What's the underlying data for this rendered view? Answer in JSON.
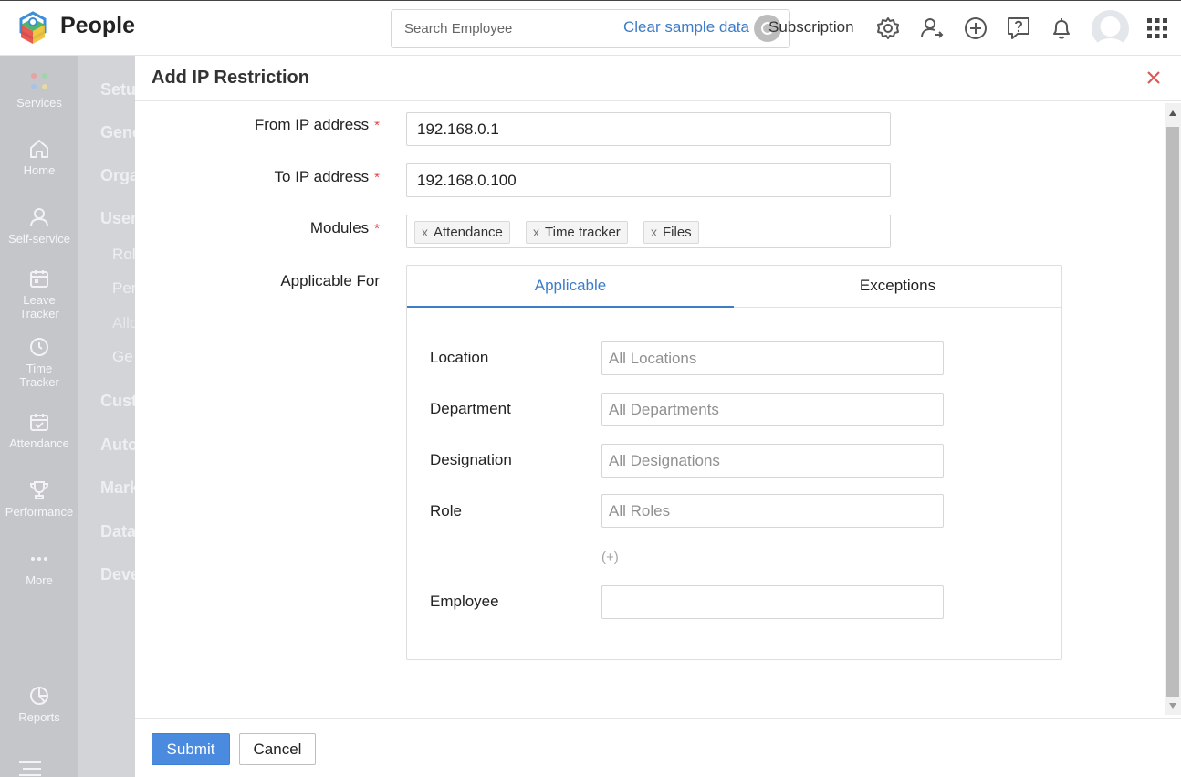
{
  "header": {
    "app_name": "People",
    "search_placeholder": "Search Employee",
    "clear_sample_data": "Clear sample data",
    "subscription": "Subscription",
    "icons": [
      "settings-icon",
      "user-switch-icon",
      "add-icon",
      "help-icon",
      "bell-icon",
      "avatar",
      "apps-grid-icon"
    ]
  },
  "leftnav": {
    "items": [
      {
        "label": "Services",
        "icon": "services-icon"
      },
      {
        "label": "Home",
        "icon": "home-icon"
      },
      {
        "label": "Self-service",
        "icon": "user-icon"
      },
      {
        "label": "Leave Tracker",
        "icon": "calendar-icon"
      },
      {
        "label": "Time Tracker",
        "icon": "clock-icon"
      },
      {
        "label": "Attendance",
        "icon": "calendar-check-icon"
      },
      {
        "label": "Performance",
        "icon": "trophy-icon"
      },
      {
        "label": "More",
        "icon": "more-icon"
      },
      {
        "label": "Reports",
        "icon": "pie-chart-icon"
      }
    ]
  },
  "subnav": {
    "items": [
      "Setu",
      "Gene",
      "Orga",
      "User",
      "Rol",
      "Per",
      "Allo",
      "Ge",
      "Cust",
      "Auto",
      "Mark",
      "Data",
      "Deve"
    ]
  },
  "dialog": {
    "title": "Add IP Restriction",
    "fields": {
      "from_ip": {
        "label": "From IP address",
        "value": "192.168.0.1",
        "required": "*"
      },
      "to_ip": {
        "label": "To IP address",
        "value": "192.168.0.100",
        "required": "*"
      },
      "modules": {
        "label": "Modules",
        "required": "*",
        "chips": [
          "Attendance",
          "Time tracker",
          "Files"
        ],
        "chip_remove": "x"
      },
      "applicable_for": {
        "label": "Applicable For"
      }
    },
    "tabs": {
      "applicable": "Applicable",
      "exceptions": "Exceptions"
    },
    "applicable": {
      "location": {
        "label": "Location",
        "placeholder": "All Locations"
      },
      "department": {
        "label": "Department",
        "placeholder": "All Departments"
      },
      "designation": {
        "label": "Designation",
        "placeholder": "All Designations"
      },
      "role": {
        "label": "Role",
        "placeholder": "All Roles"
      },
      "add_more": "(+)",
      "employee": {
        "label": "Employee",
        "value": ""
      }
    },
    "footer": {
      "submit": "Submit",
      "cancel": "Cancel"
    }
  },
  "colors": {
    "accent": "#3d7cc9",
    "primary_button": "#4a8be0",
    "required": "#e04a4a",
    "close": "#e05656"
  }
}
